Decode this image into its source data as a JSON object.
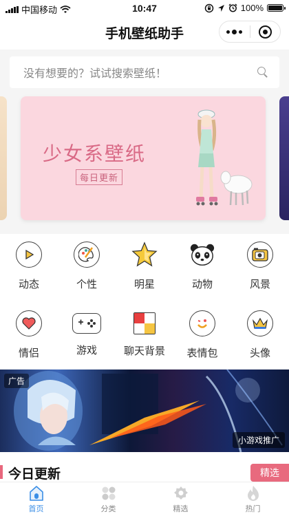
{
  "status_bar": {
    "carrier": "中国移动",
    "time": "10:47",
    "battery": "100%",
    "battery_level": 1.0
  },
  "nav": {
    "title": "手机壁纸助手"
  },
  "search": {
    "placeholder": "没有想要的？试试搜索壁纸！"
  },
  "banner": {
    "title": "少女系壁纸",
    "subtitle": "每日更新"
  },
  "categories": [
    {
      "label": "动态",
      "icon": "play-icon"
    },
    {
      "label": "个性",
      "icon": "palette-icon"
    },
    {
      "label": "明星",
      "icon": "star-icon"
    },
    {
      "label": "动物",
      "icon": "panda-icon"
    },
    {
      "label": "风景",
      "icon": "camera-icon"
    },
    {
      "label": "情侣",
      "icon": "heart-icon"
    },
    {
      "label": "游戏",
      "icon": "gamepad-icon"
    },
    {
      "label": "聊天背景",
      "icon": "color-blocks-icon"
    },
    {
      "label": "表情包",
      "icon": "emoji-face-icon"
    },
    {
      "label": "头像",
      "icon": "crown-icon"
    }
  ],
  "ad": {
    "tag": "广告",
    "promo": "小游戏推广"
  },
  "section": {
    "title": "今日更新",
    "more": "精选"
  },
  "tabbar": [
    {
      "label": "首页",
      "active": true,
      "icon": "home-icon"
    },
    {
      "label": "分类",
      "active": false,
      "icon": "category-icon"
    },
    {
      "label": "精选",
      "active": false,
      "icon": "gear-badge-icon"
    },
    {
      "label": "热门",
      "active": false,
      "icon": "flame-icon"
    }
  ],
  "colors": {
    "accent": "#3a8ee6",
    "pink": "#e86a7e",
    "banner_bg": "#fbd7df"
  }
}
